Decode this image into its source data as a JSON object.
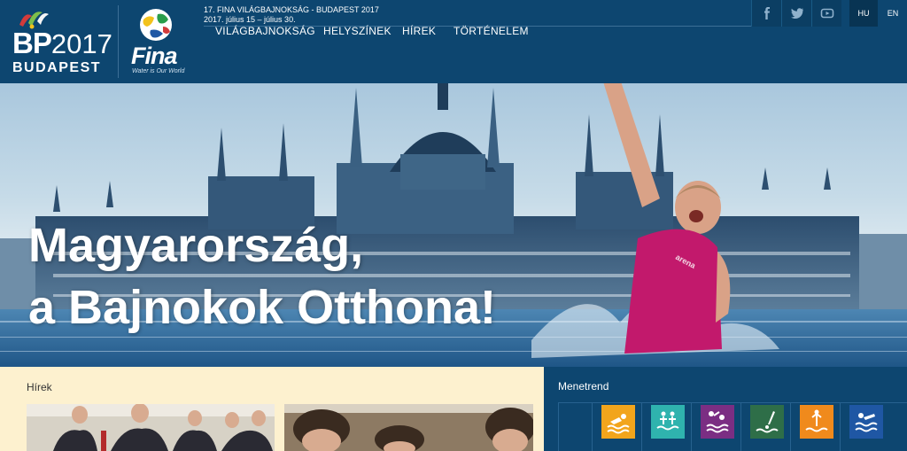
{
  "header": {
    "logo_bp_mark": "B",
    "logo_bp_mark2": "P",
    "logo_bp_year": "2017",
    "logo_bp_city": "BUDAPEST",
    "logo_fina_word": "Fina",
    "logo_fina_tagline": "Water is Our World",
    "event_title": "17. FINA VILÁGBAJNOKSÁG - BUDAPEST 2017",
    "event_dates": "2017. július 15 – július 30."
  },
  "nav": {
    "items": [
      {
        "label": "VILÁGBAJNOKSÁG"
      },
      {
        "label": "HELYSZÍNEK"
      },
      {
        "label": "HÍREK"
      },
      {
        "label": "TÖRTÉNELEM"
      }
    ]
  },
  "social": {
    "icons": [
      "facebook-icon",
      "twitter-icon",
      "youtube-icon"
    ]
  },
  "languages": {
    "active": "HU",
    "items": [
      {
        "label": "HU"
      },
      {
        "label": "EN"
      }
    ]
  },
  "hero": {
    "title_line1": "Magyarország,",
    "title_line2": "a Bajnokok Otthona!",
    "swimsuit_brand": "arena"
  },
  "news": {
    "heading": "Hírek"
  },
  "schedule": {
    "heading": "Menetrend",
    "sports": [
      {
        "name": "swimming-icon",
        "color": "#f2a51c"
      },
      {
        "name": "synchronized-swimming-icon",
        "color": "#2fb3ae"
      },
      {
        "name": "water-polo-icon",
        "color": "#7b2e83"
      },
      {
        "name": "high-diving-icon",
        "color": "#2e6e48"
      },
      {
        "name": "diving-icon",
        "color": "#f08a1c"
      },
      {
        "name": "open-water-icon",
        "color": "#1f57a4"
      }
    ]
  },
  "colors": {
    "header_bg": "#0d4670",
    "news_bg": "#fdf1cf",
    "schedule_bg": "#0d4670"
  }
}
